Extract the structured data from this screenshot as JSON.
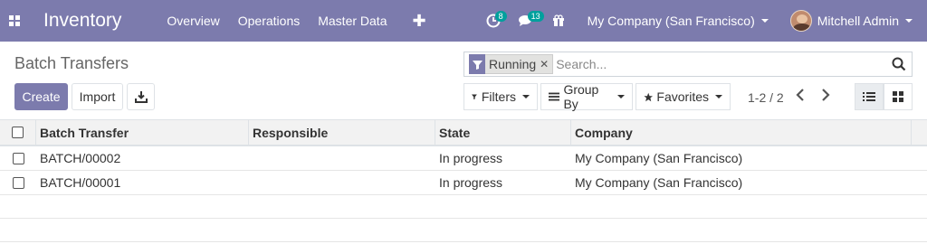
{
  "navbar": {
    "app_name": "Inventory",
    "menu": [
      "Overview",
      "Operations",
      "Master Data"
    ],
    "activity_count": "8",
    "messages_count": "13",
    "company": "My Company (San Francisco)",
    "user": "Mitchell Admin"
  },
  "control_panel": {
    "title": "Batch Transfers",
    "create_label": "Create",
    "import_label": "Import",
    "search": {
      "facet": "Running",
      "placeholder": "Search..."
    },
    "filters_label": "Filters",
    "group_by_label": "Group By",
    "favorites_label": "Favorites",
    "pager": "1-2 / 2"
  },
  "table": {
    "columns": [
      "Batch Transfer",
      "Responsible",
      "State",
      "Company"
    ],
    "rows": [
      {
        "name": "BATCH/00002",
        "responsible": "",
        "state": "In progress",
        "company": "My Company (San Francisco)"
      },
      {
        "name": "BATCH/00001",
        "responsible": "",
        "state": "In progress",
        "company": "My Company (San Francisco)"
      }
    ]
  },
  "colors": {
    "brand": "#7c7bad",
    "badge": "#00a09d"
  }
}
